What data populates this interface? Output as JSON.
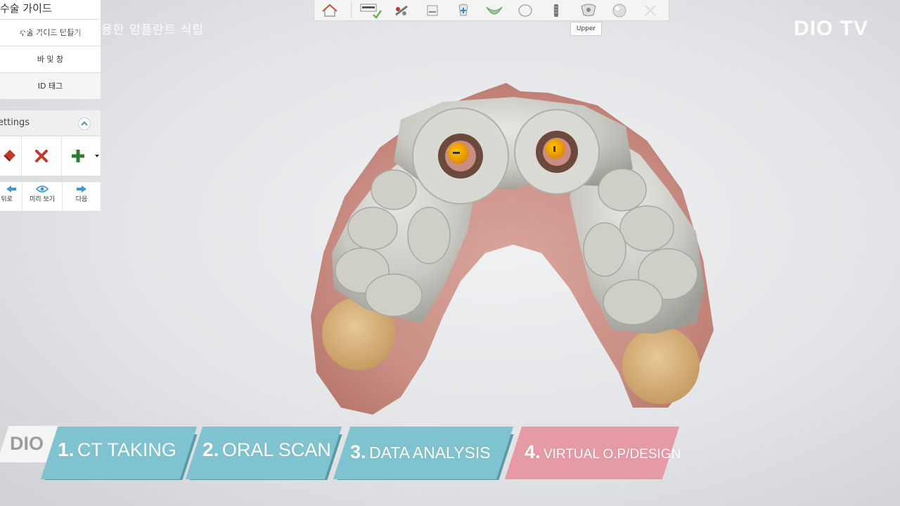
{
  "panel": {
    "title": "수술 가이드",
    "menu": [
      "수술 가이드 만들기",
      "바 및 창",
      "ID 태그"
    ],
    "settings_label": "ettings",
    "nav": [
      {
        "label": "뒤로",
        "icon": "arrow-left-icon"
      },
      {
        "label": "미리 보기",
        "icon": "eye-icon"
      },
      {
        "label": "다음",
        "icon": "arrow-right-icon"
      }
    ]
  },
  "toolbar": {
    "items": [
      "home-icon",
      "scan-check-icon",
      "tools-icon",
      "tray-icon",
      "implant-plus-icon",
      "gum-icon",
      "tooth-icon",
      "implant-screw-icon",
      "upper-guide-icon",
      "sphere-icon",
      "faded-icon"
    ],
    "tooltip": "Upper"
  },
  "watermark": {
    "subtitle": "DIOnavi를 이용한 임플란트 식립",
    "brand": "DIO TV"
  },
  "banner": {
    "logo": "DIO",
    "steps": [
      {
        "num": "1.",
        "label": "CT TAKING",
        "color": "#7fc3d0"
      },
      {
        "num": "2.",
        "label": "ORAL SCAN",
        "color": "#7fc3d0"
      },
      {
        "num": "3.",
        "label": "DATA ANALYSIS",
        "color": "#7fc3d0"
      },
      {
        "num": "4.",
        "label": "VIRTUAL O.P/DESIGN",
        "color": "#e59aa6"
      }
    ]
  }
}
